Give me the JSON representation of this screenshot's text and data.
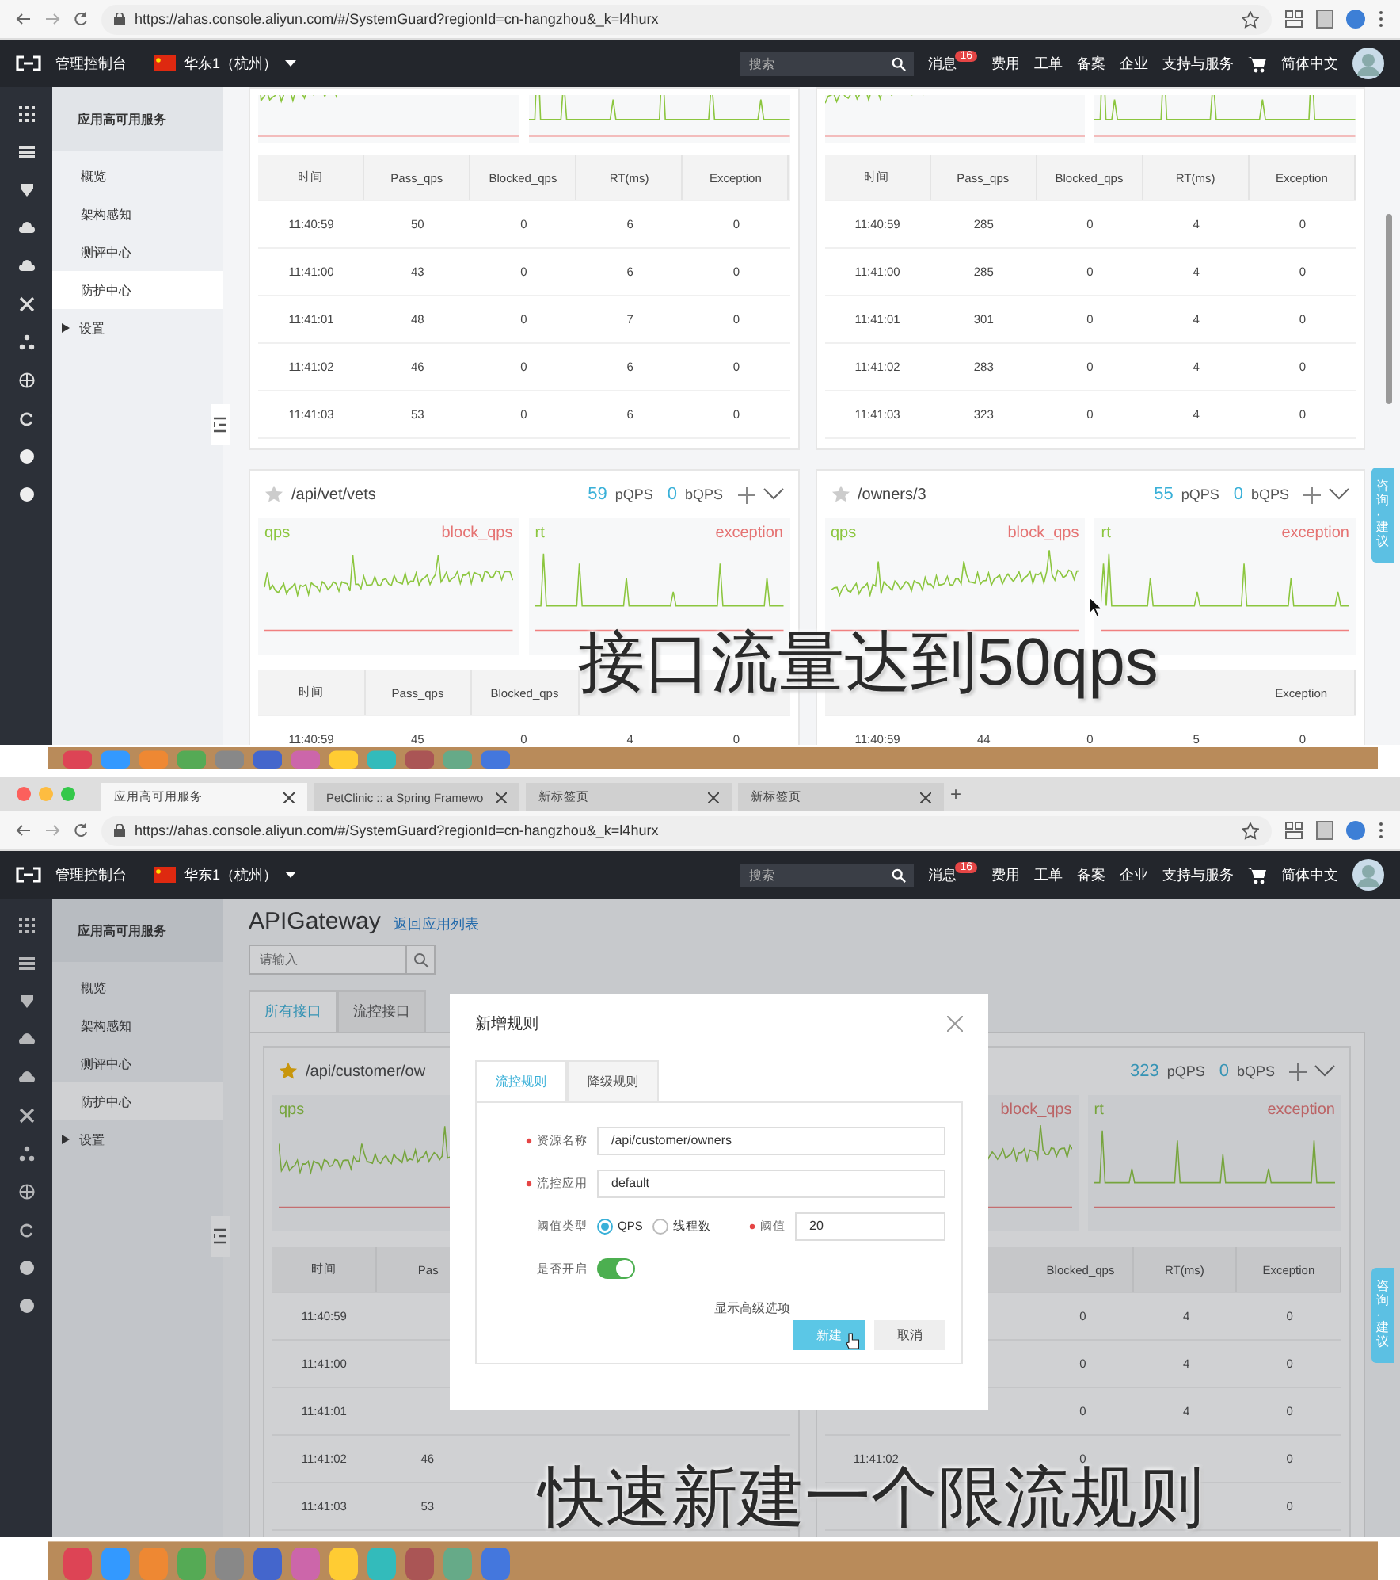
{
  "frame_1": {
    "url": "https://ahas.console.aliyun.com/#/SystemGuard?regionId=cn-hangzhou&_k=l4hurx",
    "nav": {
      "console": "管理控制台",
      "region": "华东1（杭州）",
      "search_placeholder": "搜索",
      "items": [
        {
          "label": "消息",
          "badge": "16"
        },
        {
          "label": "费用"
        },
        {
          "label": "工单"
        },
        {
          "label": "备案"
        },
        {
          "label": "企业"
        },
        {
          "label": "支持与服务"
        }
      ],
      "language": "简体中文"
    },
    "sidebar": {
      "title": "应用高可用服务",
      "items": [
        {
          "label": "概览",
          "selected": false
        },
        {
          "label": "架构感知",
          "selected": false
        },
        {
          "label": "测评中心",
          "selected": false
        },
        {
          "label": "防护中心",
          "selected": true
        },
        {
          "label": "设置",
          "selected": false,
          "expanded": false
        }
      ]
    },
    "cards": [
      {
        "kind": "scrolled",
        "table": {
          "columns": [
            "时间",
            "Pass_qps",
            "Blocked_qps",
            "RT(ms)",
            "Exception"
          ],
          "rows": [
            [
              "11:40:59",
              "50",
              "0",
              "6",
              "0"
            ],
            [
              "11:41:00",
              "43",
              "0",
              "6",
              "0"
            ],
            [
              "11:41:01",
              "48",
              "0",
              "7",
              "0"
            ],
            [
              "11:41:02",
              "46",
              "0",
              "6",
              "0"
            ],
            [
              "11:41:03",
              "53",
              "0",
              "6",
              "0"
            ]
          ]
        }
      },
      {
        "kind": "scrolled",
        "table": {
          "columns": [
            "时间",
            "Pass_qps",
            "Blocked_qps",
            "RT(ms)",
            "Exception"
          ],
          "rows": [
            [
              "11:40:59",
              "285",
              "0",
              "4",
              "0"
            ],
            [
              "11:41:00",
              "285",
              "0",
              "4",
              "0"
            ],
            [
              "11:41:01",
              "301",
              "0",
              "4",
              "0"
            ],
            [
              "11:41:02",
              "283",
              "0",
              "4",
              "0"
            ],
            [
              "11:41:03",
              "323",
              "0",
              "4",
              "0"
            ]
          ]
        }
      },
      {
        "kind": "full",
        "header": {
          "starred": false,
          "title": "/api/vet/vets",
          "pqps": "59",
          "pqps_label": "pQPS",
          "bqps": "0",
          "bqps_label": "bQPS"
        },
        "charts": [
          {
            "left": "qps",
            "right": "block_qps"
          },
          {
            "left": "rt",
            "right": "exception"
          }
        ],
        "table": {
          "columns": [
            "时间",
            "Pass_qps",
            "Blocked_qps",
            null,
            null
          ],
          "rows": [
            [
              "11:40:59",
              "45",
              "0",
              "4",
              "0"
            ]
          ]
        }
      },
      {
        "kind": "full",
        "header": {
          "starred": false,
          "title": "/owners/3",
          "pqps": "55",
          "pqps_label": "pQPS",
          "bqps": "0",
          "bqps_label": "bQPS"
        },
        "charts": [
          {
            "left": "qps",
            "right": "block_qps"
          },
          {
            "left": "rt",
            "right": "exception"
          }
        ],
        "table": {
          "columns": [
            null,
            null,
            null,
            null,
            "Exception"
          ],
          "rows": [
            [
              "11:40:59",
              "44",
              "0",
              "5",
              "0"
            ]
          ]
        }
      }
    ],
    "feedback": "咨询·建议",
    "subtitle": "接口流量达到50qps"
  },
  "frame_2": {
    "tabs": [
      {
        "label": "应用高可用服务",
        "selected": true
      },
      {
        "label": "PetClinic :: a Spring Framewo",
        "selected": false
      },
      {
        "label": "新标签页",
        "selected": false
      },
      {
        "label": "新标签页",
        "selected": false
      }
    ],
    "new_tab": "+",
    "url": "https://ahas.console.aliyun.com/#/SystemGuard?regionId=cn-hangzhou&_k=l4hurx",
    "nav": {
      "console": "管理控制台",
      "region": "华东1（杭州）",
      "search_placeholder": "搜索",
      "items": [
        {
          "label": "消息",
          "badge": "16"
        },
        {
          "label": "费用"
        },
        {
          "label": "工单"
        },
        {
          "label": "备案"
        },
        {
          "label": "企业"
        },
        {
          "label": "支持与服务"
        }
      ],
      "language": "简体中文"
    },
    "sidebar": {
      "title": "应用高可用服务",
      "items": [
        {
          "label": "概览",
          "selected": false
        },
        {
          "label": "架构感知",
          "selected": false
        },
        {
          "label": "测评中心",
          "selected": false
        },
        {
          "label": "防护中心",
          "selected": true
        },
        {
          "label": "设置",
          "selected": false,
          "expanded": false
        }
      ]
    },
    "app_title": "APIGateway",
    "back_link": "返回应用列表",
    "search_placeholder": "请输入",
    "view_tabs": [
      {
        "label": "所有接口",
        "selected": true
      },
      {
        "label": "流控接口",
        "selected": false
      }
    ],
    "cards": [
      {
        "kind": "full",
        "header": {
          "starred": true,
          "title": "/api/customer/ow"
        },
        "charts": [
          {
            "left": "qps"
          }
        ],
        "table": {
          "columns": [
            "时间",
            "Pas",
            null,
            null,
            null
          ],
          "rows": [
            [
              "11:40:59",
              null,
              null,
              null,
              null
            ],
            [
              "11:41:00",
              null,
              null,
              null,
              null
            ],
            [
              "11:41:01",
              null,
              null,
              null,
              null
            ],
            [
              "11:41:02",
              "46",
              null,
              null,
              null
            ],
            [
              "11:41:03",
              "53",
              null,
              null,
              null
            ]
          ]
        }
      },
      {
        "kind": "full",
        "header": {
          "pqps": "323",
          "pqps_label": "pQPS",
          "bqps": "0",
          "bqps_label": "bQPS"
        },
        "charts": [
          {
            "right": "block_qps"
          },
          {
            "left": "rt",
            "right": "exception"
          }
        ],
        "table": {
          "columns": [
            null,
            null,
            "Blocked_qps",
            "RT(ms)",
            "Exception"
          ],
          "rows": [
            [
              null,
              null,
              "0",
              "4",
              "0"
            ],
            [
              null,
              null,
              "0",
              "4",
              "0"
            ],
            [
              null,
              null,
              "0",
              "4",
              "0"
            ],
            [
              "11:41:02",
              null,
              "0",
              null,
              "0"
            ],
            [
              null,
              null,
              null,
              null,
              "0"
            ]
          ]
        }
      }
    ],
    "dialog": {
      "title": "新增规则",
      "tabs": [
        {
          "label": "流控规则",
          "selected": true
        },
        {
          "label": "降级规则",
          "selected": false
        }
      ],
      "fields": [
        {
          "kind": "text",
          "label": "资源名称",
          "required": true,
          "value": "/api/customer/owners"
        },
        {
          "kind": "text",
          "label": "流控应用",
          "required": true,
          "value": "default"
        },
        {
          "kind": "threshold",
          "label": "阈值类型",
          "required": false,
          "options": [
            {
              "label": "QPS",
              "selected": true
            },
            {
              "label": "线程数",
              "selected": false
            }
          ],
          "value_label": "阈值",
          "value_required": true,
          "value": "20"
        },
        {
          "kind": "switch",
          "label": "是否开启",
          "required": false,
          "on": true
        }
      ],
      "advanced_link": "显示高级选项",
      "primary_button": "新建",
      "cancel_button": "取消"
    },
    "feedback": "咨询·建议",
    "subtitle": "快速新建一个限流规则"
  }
}
